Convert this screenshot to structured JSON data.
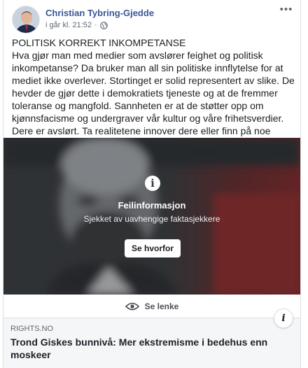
{
  "post": {
    "author": "Christian Tybring-Gjedde",
    "timestamp": "i går kl. 21:52",
    "separator": "·",
    "more_label": "•••",
    "text_title": "POLITISK KORREKT INKOMPETANSE",
    "text_body": "Hva gjør man med medier som avslører feighet og politisk inkompetanse? Da bruker man all sin politiske innflytelse for at mediet ikke overlever. Stortinget er solid representert av slike. De hevder de gjør dette i demokratiets tjeneste og at de fremmer toleranse og mangfold. Sannheten er at de støtter opp om kjønnsfacisme og undergraver vår kultur og våre frihetsverdier. Dere er avslørt. Ta realitetene innover dere eller finn på noe annet å gjøre."
  },
  "fact_check": {
    "icon": "i",
    "title": "Feilinformasjon",
    "subtitle": "Sjekket av uavhengige faktasjekkere",
    "button_label": "Se hvorfor"
  },
  "see_link": {
    "label": "Se lenke",
    "icon": "eye-icon"
  },
  "link_preview": {
    "domain": "RIGHTS.NO",
    "headline": "Trond Giskes bunnivå: Mer ekstremisme i bedehus enn moskeer",
    "info_icon": "i"
  },
  "colors": {
    "author_link": "#385898",
    "secondary_text": "#606770",
    "preview_bg": "#f5f6f7",
    "accent_red": "#c22a2a"
  }
}
